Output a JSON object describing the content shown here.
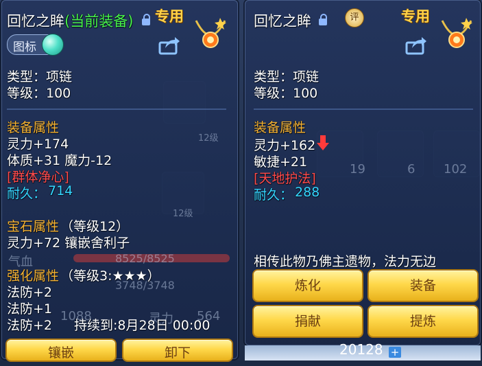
{
  "left_panel": {
    "title": "回忆之眸",
    "equipped_tag": "(当前装备)",
    "exclusive_label": "专用",
    "toggle_label": "图标",
    "type_line": "类型：项链",
    "level_line": "等级：100",
    "equip_attr_header": "装备属性",
    "attr_line1": "灵力+174",
    "attr_line2": "体质+31 魔力-12",
    "skill": "[群体净心]",
    "durability_label": "耐久：",
    "durability_value": "714",
    "gem_header": "宝石属性",
    "gem_level": "（等级12）",
    "gem_line": "灵力+72 镶嵌舍利子",
    "enhance_header": "强化属性",
    "enhance_level": "（等级3:★★★）",
    "enhance_line1": "法防+2",
    "enhance_line2": "法防+1",
    "enhance_line3": "法防+2",
    "enhance_duration": "持续到:8月28日 00:00",
    "button_inlay": "镶嵌",
    "button_unequip": "卸下"
  },
  "right_panel": {
    "title": "回忆之眸",
    "rate_label": "评",
    "exclusive_label": "专用",
    "type_line": "类型：项链",
    "level_line": "等级：100",
    "equip_attr_header": "装备属性",
    "attr_line1": "灵力+162",
    "attr_line2": "敏捷+21",
    "skill": "[天地护法]",
    "durability_label": "耐久：",
    "durability_value": "288",
    "description": "相传此物乃佛主遗物，法力无边",
    "buttons": [
      "炼化",
      "装备",
      "捐献",
      "提炼"
    ]
  },
  "background": {
    "cell_numbers": [
      "19",
      "6",
      "102",
      "12级",
      "12级"
    ],
    "stat_hp_label": "气血",
    "stat_hp_value": "8525/8525",
    "stat_mp_value": "3748/3748",
    "bottom_left": "1088",
    "bottom_right": "564",
    "bottom_right_label": "灵力",
    "money": "20128"
  }
}
